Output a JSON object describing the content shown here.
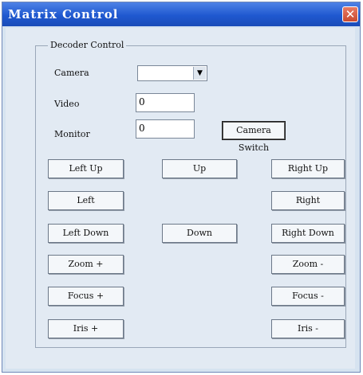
{
  "window": {
    "title": "Matrix Control",
    "close_glyph": "✕"
  },
  "group": {
    "legend": "Decoder Control"
  },
  "fields": {
    "camera": {
      "label": "Camera",
      "value": ""
    },
    "video": {
      "label": "Video",
      "value": "0"
    },
    "monitor": {
      "label": "Monitor",
      "value": "0"
    }
  },
  "buttons": {
    "camera_switch": "Camera Switch",
    "left_up": "Left Up",
    "up": "Up",
    "right_up": "Right Up",
    "left": "Left",
    "right": "Right",
    "left_down": "Left Down",
    "down": "Down",
    "right_down": "Right Down",
    "zoom_plus": "Zoom +",
    "zoom_minus": "Zoom -",
    "focus_plus": "Focus +",
    "focus_minus": "Focus -",
    "iris_plus": "Iris +",
    "iris_minus": "Iris -"
  },
  "icons": {
    "dropdown_arrow": "▼"
  }
}
